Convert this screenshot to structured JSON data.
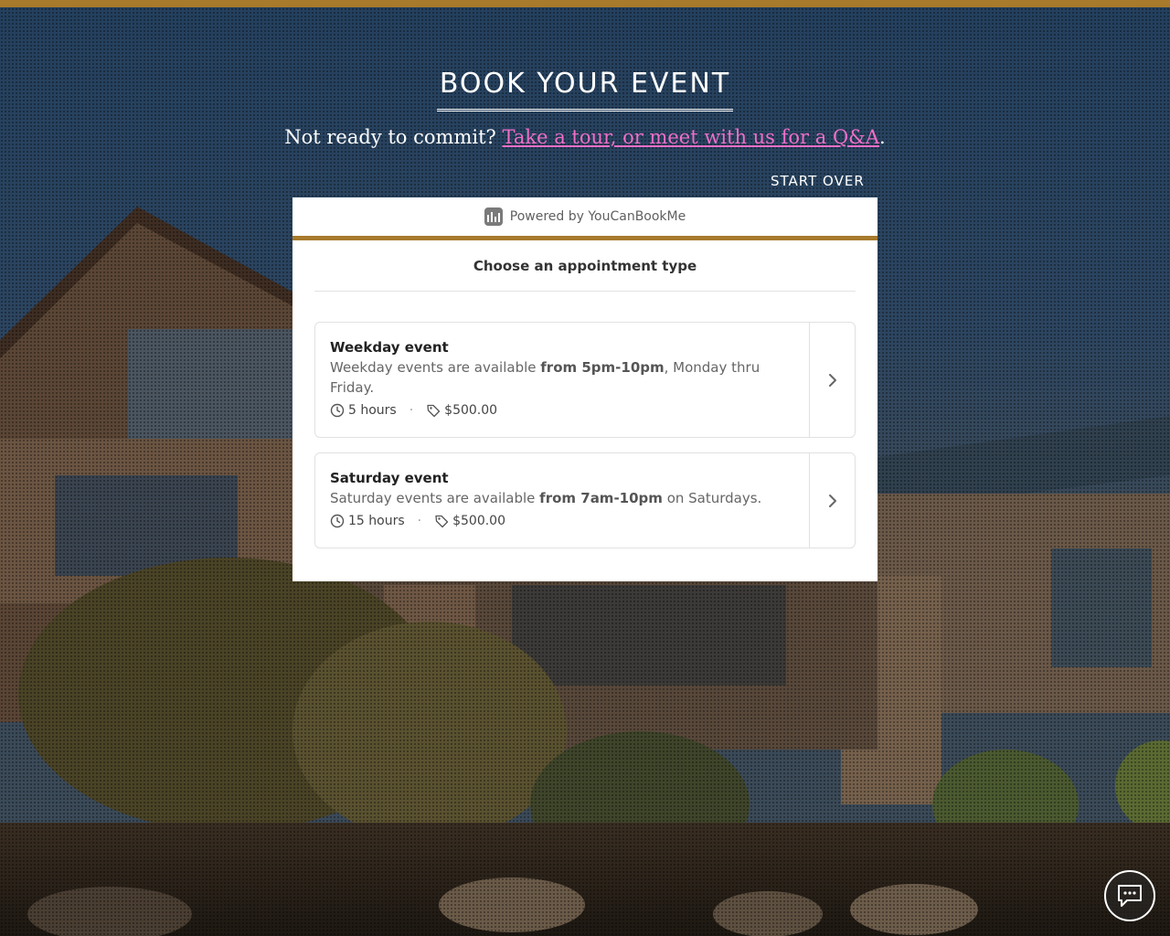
{
  "header": {
    "title": "BOOK YOUR EVENT",
    "subtitle_prefix": "Not ready to commit?",
    "subtitle_link": "Take a tour, or meet with us for a Q&A",
    "subtitle_suffix": ".",
    "start_over": "START OVER"
  },
  "booking": {
    "powered_by": "Powered by YouCanBookMe",
    "heading": "Choose an appointment type",
    "options": [
      {
        "name": "Weekday event",
        "desc_before": "Weekday events are available ",
        "desc_bold": "from 5pm-10pm",
        "desc_after": ", Monday thru Friday.",
        "duration": "5 hours",
        "price": "$500.00"
      },
      {
        "name": "Saturday event",
        "desc_before": "Saturday events are available ",
        "desc_bold": "from 7am-10pm",
        "desc_after": " on Saturdays.",
        "duration": "15 hours",
        "price": "$500.00"
      }
    ]
  },
  "icons": {
    "duration": "clock-icon",
    "price": "tag-icon",
    "option_arrow": "chevron-right-icon",
    "chat": "chat-bubble-icon",
    "brand": "youcanbookme-logo-icon"
  },
  "colors": {
    "accent": "#a77a2c",
    "link": "#f06fc8"
  }
}
